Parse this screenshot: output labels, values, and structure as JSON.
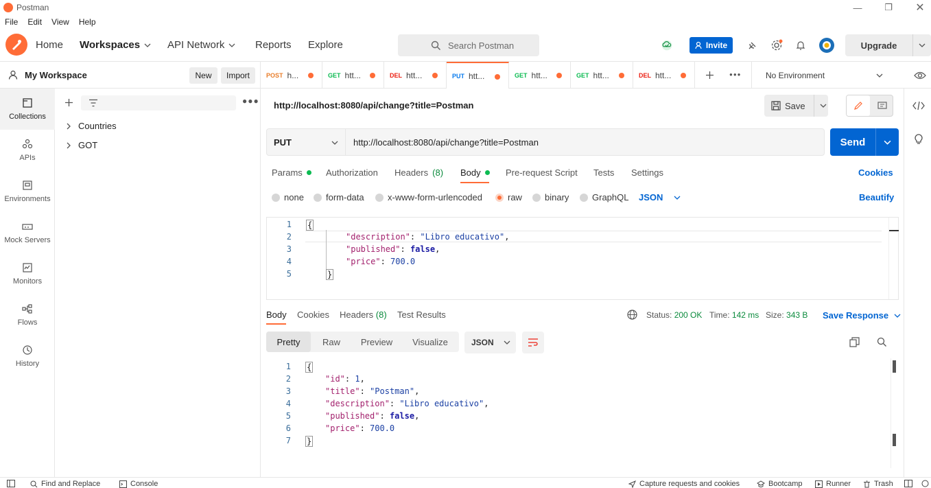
{
  "app": {
    "title": "Postman"
  },
  "menu": [
    "File",
    "Edit",
    "View",
    "Help"
  ],
  "header": {
    "home": "Home",
    "workspaces": "Workspaces",
    "api_network": "API Network",
    "reports": "Reports",
    "explore": "Explore",
    "search_placeholder": "Search Postman",
    "invite": "Invite",
    "upgrade": "Upgrade"
  },
  "workspace": {
    "title": "My Workspace",
    "new": "New",
    "import": "Import"
  },
  "rail": [
    "Collections",
    "APIs",
    "Environments",
    "Mock Servers",
    "Monitors",
    "Flows",
    "History"
  ],
  "collections": [
    "Countries",
    "GOT"
  ],
  "tabs": [
    {
      "method": "POST",
      "label": "h...",
      "color": "#b56b00"
    },
    {
      "method": "GET",
      "label": "htt...",
      "color": "#0cbb52"
    },
    {
      "method": "DEL",
      "label": "htt...",
      "color": "#eb2013"
    },
    {
      "method": "PUT",
      "label": "htt...",
      "color": "#097bed"
    },
    {
      "method": "GET",
      "label": "htt...",
      "color": "#0cbb52"
    },
    {
      "method": "GET",
      "label": "htt...",
      "color": "#0cbb52"
    },
    {
      "method": "DEL",
      "label": "htt...",
      "color": "#eb2013"
    }
  ],
  "environment": "No Environment",
  "request": {
    "title": "http://localhost:8080/api/change?title=Postman",
    "save": "Save",
    "method": "PUT",
    "url": "http://localhost:8080/api/change?title=Postman",
    "send": "Send",
    "tabs": {
      "params": "Params",
      "authorization": "Authorization",
      "headers": "Headers",
      "headers_count": "(8)",
      "body": "Body",
      "prerequest": "Pre-request Script",
      "tests": "Tests",
      "settings": "Settings"
    },
    "cookies": "Cookies",
    "beautify": "Beautify",
    "body_types": [
      "none",
      "form-data",
      "x-www-form-urlencoded",
      "raw",
      "binary",
      "GraphQL"
    ],
    "body_format": "JSON",
    "body_lines": [
      {
        "n": "1",
        "text": "{"
      },
      {
        "n": "2",
        "key": "\"description\"",
        "value": "\"Libro educativo\"",
        "tail": ","
      },
      {
        "n": "3",
        "key": "\"published\"",
        "value": "false",
        "tail": ","
      },
      {
        "n": "4",
        "key": "\"price\"",
        "value": "700.0",
        "tail": ""
      },
      {
        "n": "5",
        "text": "}"
      }
    ]
  },
  "response": {
    "tabs": {
      "body": "Body",
      "cookies": "Cookies",
      "headers": "Headers",
      "headers_count": "(8)",
      "tests": "Test Results"
    },
    "status_label": "Status:",
    "status_value": "200 OK",
    "time_label": "Time:",
    "time_value": "142 ms",
    "size_label": "Size:",
    "size_value": "343 B",
    "save_response": "Save Response",
    "views": [
      "Pretty",
      "Raw",
      "Preview",
      "Visualize"
    ],
    "format": "JSON",
    "lines": [
      {
        "n": "1",
        "text": "{"
      },
      {
        "n": "2",
        "key": "\"id\"",
        "value": "1",
        "tail": ","
      },
      {
        "n": "3",
        "key": "\"title\"",
        "value": "\"Postman\"",
        "tail": ","
      },
      {
        "n": "4",
        "key": "\"description\"",
        "value": "\"Libro educativo\"",
        "tail": ","
      },
      {
        "n": "5",
        "key": "\"published\"",
        "value": "false",
        "tail": ","
      },
      {
        "n": "6",
        "key": "\"price\"",
        "value": "700.0",
        "tail": ""
      },
      {
        "n": "7",
        "text": "}"
      }
    ]
  },
  "footer": {
    "find_replace": "Find and Replace",
    "console": "Console",
    "capture": "Capture requests and cookies",
    "bootcamp": "Bootcamp",
    "runner": "Runner",
    "trash": "Trash"
  }
}
